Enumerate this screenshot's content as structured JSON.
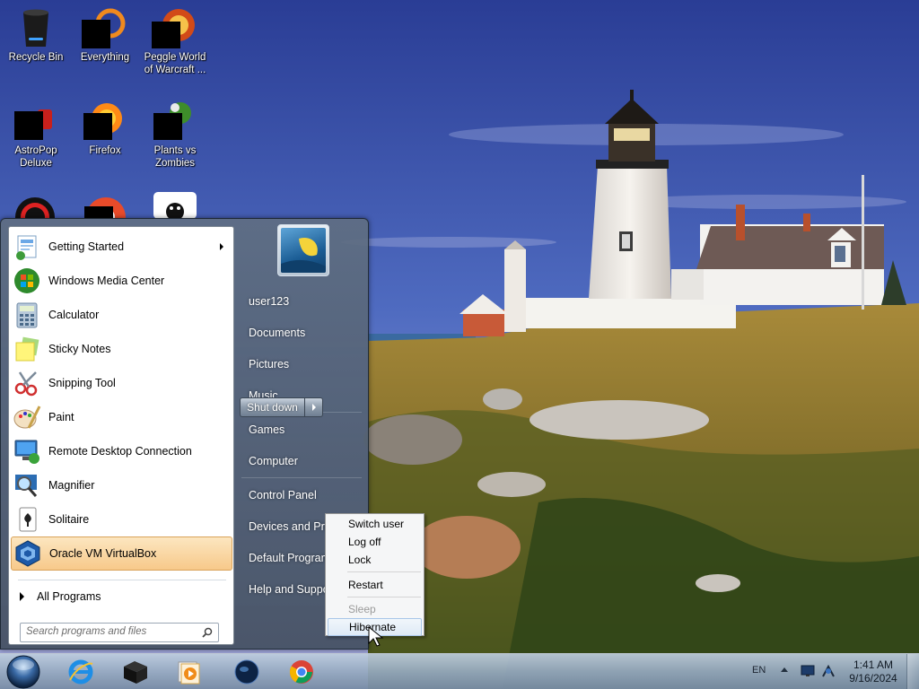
{
  "desktop": {
    "icons": [
      {
        "label": "Recycle Bin",
        "icon": "recycle-bin-icon"
      },
      {
        "label": "Everything",
        "icon": "everything-icon"
      },
      {
        "label": "Peggle World of Warcraft ...",
        "icon": "peggle-icon"
      },
      {
        "label": "AstroPop Deluxe",
        "icon": "astropop-icon"
      },
      {
        "label": "Firefox",
        "icon": "firefox-icon"
      },
      {
        "label": "Plants vs Zombies",
        "icon": "plants-vs-zombies-icon"
      }
    ]
  },
  "start_menu": {
    "programs": [
      {
        "label": "Getting Started",
        "icon": "getting-started-icon",
        "has_submenu": true
      },
      {
        "label": "Windows Media Center",
        "icon": "media-center-icon"
      },
      {
        "label": "Calculator",
        "icon": "calculator-icon"
      },
      {
        "label": "Sticky Notes",
        "icon": "sticky-notes-icon"
      },
      {
        "label": "Snipping Tool",
        "icon": "snipping-tool-icon"
      },
      {
        "label": "Paint",
        "icon": "paint-icon"
      },
      {
        "label": "Remote Desktop Connection",
        "icon": "remote-desktop-icon"
      },
      {
        "label": "Magnifier",
        "icon": "magnifier-icon"
      },
      {
        "label": "Solitaire",
        "icon": "solitaire-icon"
      },
      {
        "label": "Oracle VM VirtualBox",
        "icon": "virtualbox-icon",
        "selected": true
      }
    ],
    "all_programs": "All Programs",
    "search_placeholder": "Search programs and files",
    "right_links": [
      "user123",
      "Documents",
      "Pictures",
      "Music",
      "Games",
      "Computer",
      "Control Panel",
      "Devices and Prin",
      "Default Program",
      "Help and Suppo"
    ],
    "shutdown_label": "Shut down"
  },
  "power_menu": {
    "items": [
      {
        "label": "Switch user",
        "enabled": true
      },
      {
        "label": "Log off",
        "enabled": true
      },
      {
        "label": "Lock",
        "enabled": true
      },
      {
        "label": "Restart",
        "enabled": true
      },
      {
        "label": "Sleep",
        "enabled": false
      },
      {
        "label": "Hibernate",
        "enabled": true,
        "hovered": true
      }
    ]
  },
  "taskbar": {
    "pinned": [
      "internet-explorer-icon",
      "black-box-app-icon",
      "media-player-icon",
      "globe-app-icon",
      "chrome-icon"
    ],
    "tray": {
      "language": "EN",
      "time": "1:41 AM",
      "date": "9/16/2024"
    }
  },
  "colors": {
    "selection": "#f7c98a",
    "menu_bg": "#5f6e82",
    "taskbar": "#96aac0"
  }
}
